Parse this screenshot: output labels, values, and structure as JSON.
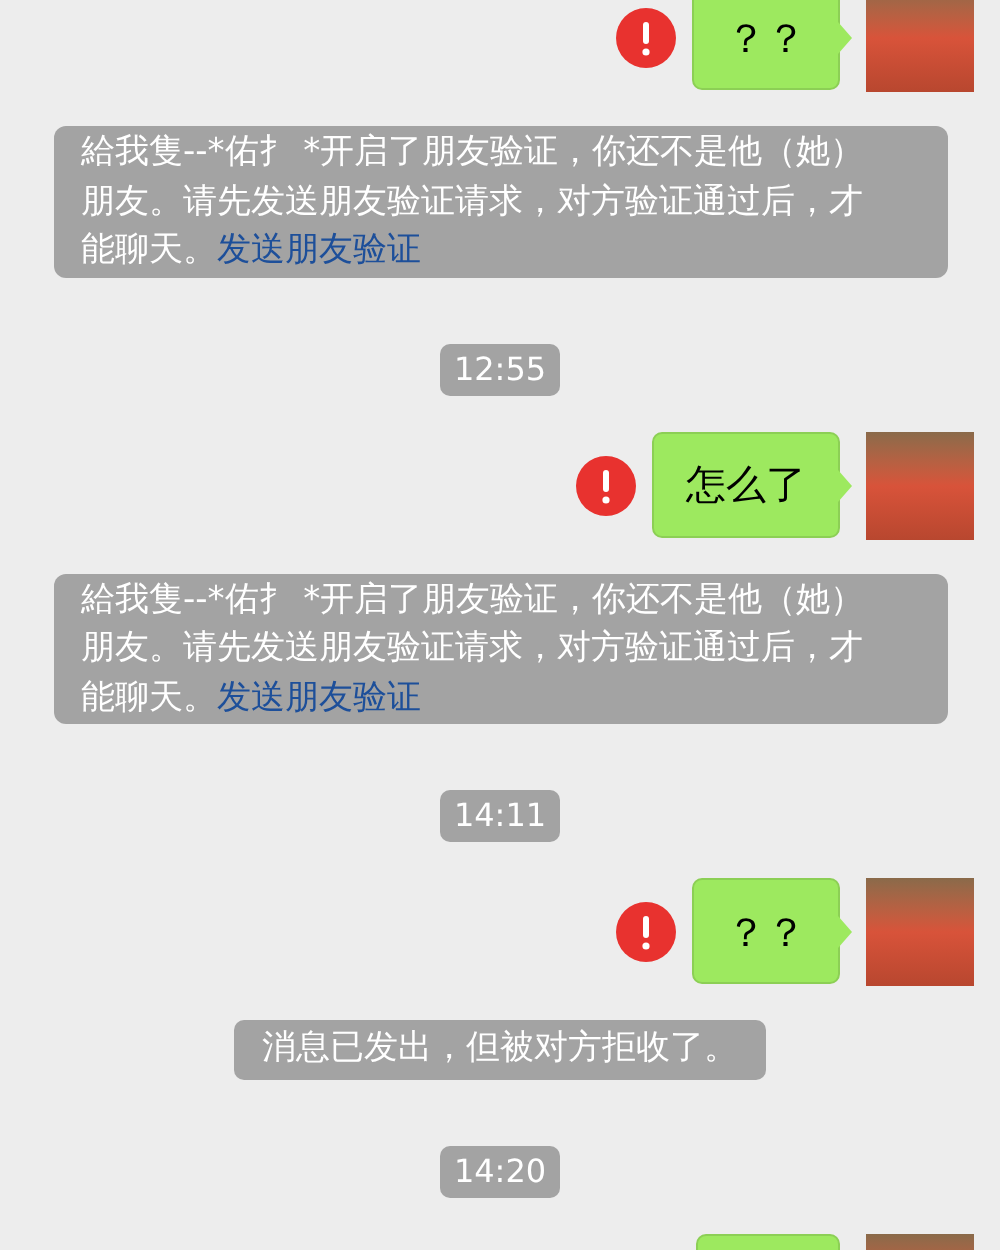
{
  "messages": [
    {
      "kind": "message",
      "text": "？？",
      "failed": true
    },
    {
      "kind": "system",
      "text": "給我隻--*佑扌 *开启了朋友验证，你还不是他（她）朋友。请先发送朋友验证请求，对方验证通过后，才能聊天。",
      "link": "发送朋友验证"
    },
    {
      "kind": "time",
      "text": "12:55"
    },
    {
      "kind": "message",
      "text": "怎么了",
      "failed": true
    },
    {
      "kind": "system",
      "text": "給我隻--*佑扌 *开启了朋友验证，你还不是他（她）朋友。请先发送朋友验证请求，对方验证通过后，才能聊天。",
      "link": "发送朋友验证"
    },
    {
      "kind": "time",
      "text": "14:11"
    },
    {
      "kind": "message",
      "text": "？？",
      "failed": true
    },
    {
      "kind": "notice",
      "text": "消息已发出，但被对方拒收了。"
    },
    {
      "kind": "time",
      "text": "14:20"
    },
    {
      "kind": "message"
    }
  ]
}
